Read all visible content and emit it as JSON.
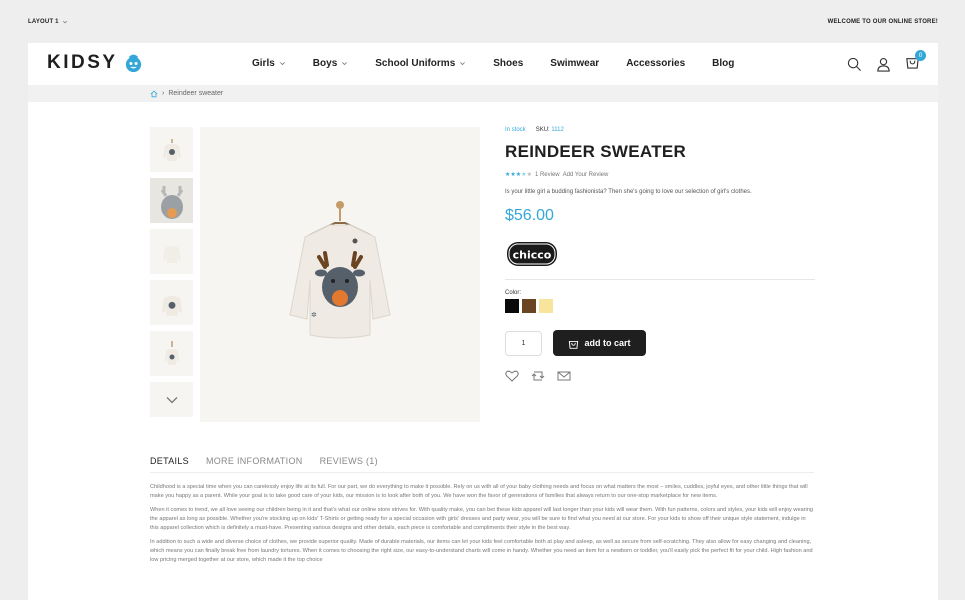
{
  "topbar": {
    "layout": "LAYOUT 1",
    "welcome": "WELCOME TO OUR ONLINE STORE!"
  },
  "logo": {
    "text": "KIDSY"
  },
  "nav": [
    {
      "label": "Girls",
      "caret": true
    },
    {
      "label": "Boys",
      "caret": true
    },
    {
      "label": "School Uniforms",
      "caret": true
    },
    {
      "label": "Shoes",
      "caret": false
    },
    {
      "label": "Swimwear",
      "caret": false
    },
    {
      "label": "Accessories",
      "caret": false
    },
    {
      "label": "Blog",
      "caret": false
    }
  ],
  "cart": {
    "count": "0"
  },
  "breadcrumb": {
    "current": "Reindeer sweater"
  },
  "product": {
    "stock": "In stock",
    "sku_label": "SKU:",
    "sku": "1112",
    "title": "REINDEER SWEATER",
    "rating": 3.5,
    "reviews": "1 Review",
    "add_review": "Add Your Review",
    "description": "Is your little girl a budding fashionista? Then she's going to love our selection of girl's clothes.",
    "price": "$56.00",
    "brand": "chicco",
    "color_label": "Color:",
    "colors": [
      "#0a0a0a",
      "#6b4421",
      "#f8e49a"
    ],
    "qty": "1",
    "add_to_cart": "add to cart"
  },
  "tabs": [
    "DETAILS",
    "MORE INFORMATION",
    "REVIEWS (1)"
  ],
  "details": [
    "Childhood is a special time when you can carelessly enjoy life at its full. For our part, we do everything to make it possible. Rely on us with all of your baby clothing needs and focus on what matters the most – smiles, cuddles, joyful eyes, and other little things that will make you happy as a parent. While your goal is to take good care of your kids, our mission is to look after both of you. We have won the favor of generations of families that always return to our one-stop marketplace for new items.",
    "When it comes to trend, we all love seeing our children being in it and that's what our online store strives for. With quality make, you can bet these kids apparel will last longer than your kids will wear them. With fun patterns, colors and styles, your kids will enjoy wearing the apparel as long as possible. Whether you're stocking up on kids' T-Shirts or getting ready for a special occasion with girls' dresses and party wear, you will be sure to find what you need at our store. For your kids to show off their unique style statement, indulge in this apparel collection which is definitely a must-have. Presenting various designs and other details, each piece is comfortable and compliments their style in the best way.",
    "In addition to such a wide and diverse choice of clothes, we provide superior quality. Made of durable materials, our items can let your kids feel comfortable both at play and asleep, as well as secure from self-scratching. They also allow for easy changing and cleaning, which means you can finally break free from laundry tortures. When it comes to choosing the right size, our easy-to-understand charts will come in handy. Whether you need an item for a newborn or toddler, you'll easily pick the perfect fit for your child. High fashion and low pricing merged together at our store, which made it the top choice"
  ]
}
